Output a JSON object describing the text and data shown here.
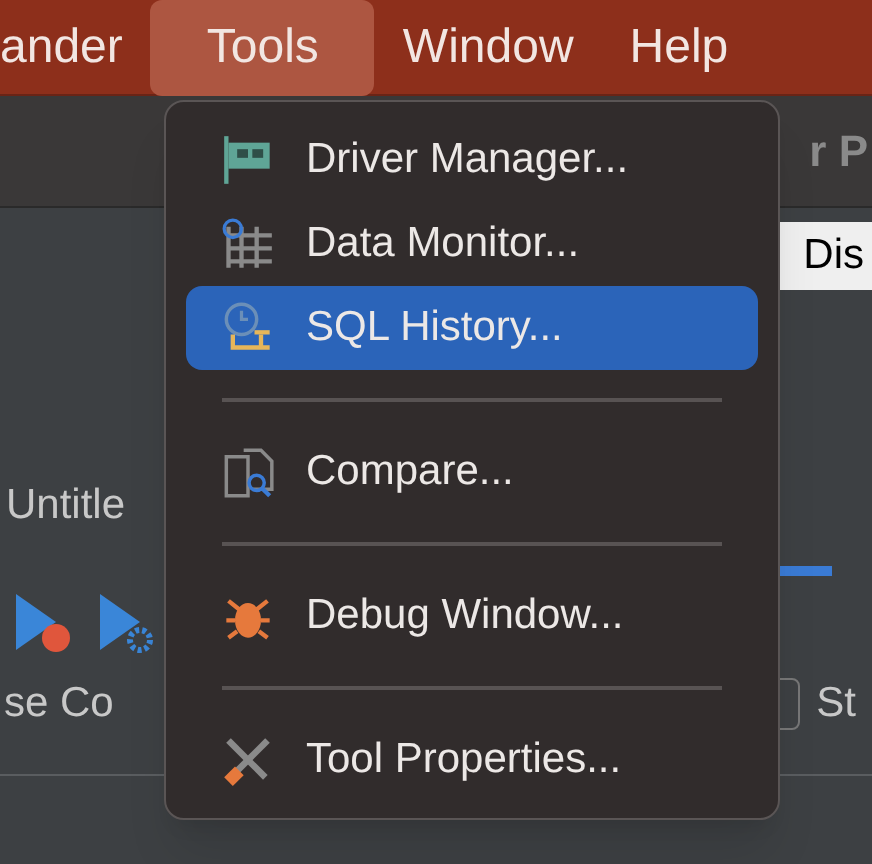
{
  "menu_bar": [
    {
      "label": "ander",
      "selected": false
    },
    {
      "label": "Tools",
      "selected": true
    },
    {
      "label": "Window",
      "selected": false
    },
    {
      "label": "Help",
      "selected": false
    }
  ],
  "window_title": "r P",
  "dialog_button": "Dis",
  "editor_tab": "Untitle",
  "connection_label": "se Co",
  "checkbox": {
    "label": "St",
    "checked": false
  },
  "tools_menu": [
    {
      "kind": "item",
      "label": "Driver Manager...",
      "selected": false
    },
    {
      "kind": "item",
      "label": "Data Monitor...",
      "selected": false
    },
    {
      "kind": "item",
      "label": "SQL History...",
      "selected": true
    },
    {
      "kind": "separator"
    },
    {
      "kind": "item",
      "label": "Compare...",
      "selected": false
    },
    {
      "kind": "separator"
    },
    {
      "kind": "item",
      "label": "Debug Window...",
      "selected": false
    },
    {
      "kind": "separator"
    },
    {
      "kind": "item",
      "label": "Tool Properties...",
      "selected": false
    }
  ]
}
